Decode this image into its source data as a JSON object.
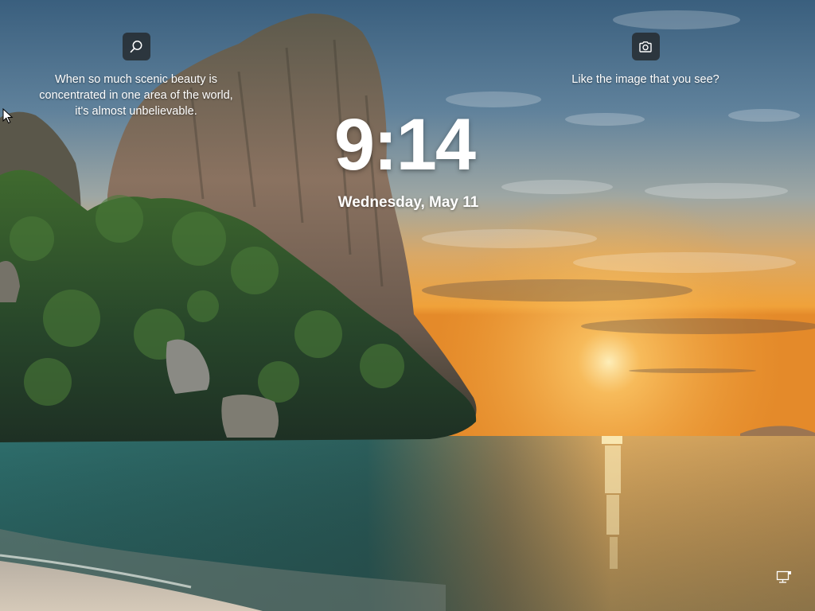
{
  "lockscreen": {
    "time": "9:14",
    "date": "Wednesday, May 11"
  },
  "spotlight": {
    "info": {
      "icon": "search-icon",
      "text": "When so much scenic beauty is\nconcentrated in one area of the world,\nit's almost unbelievable."
    },
    "like": {
      "icon": "camera-icon",
      "text": "Like the image that you see?"
    }
  },
  "tray": {
    "icon": "network-icon"
  },
  "colors": {
    "text": "#ffffff",
    "icon_bg": "#202020",
    "sky_top": "#3b5f7c",
    "sunset": "#f0a23a",
    "sea": "#2f6b6a"
  }
}
